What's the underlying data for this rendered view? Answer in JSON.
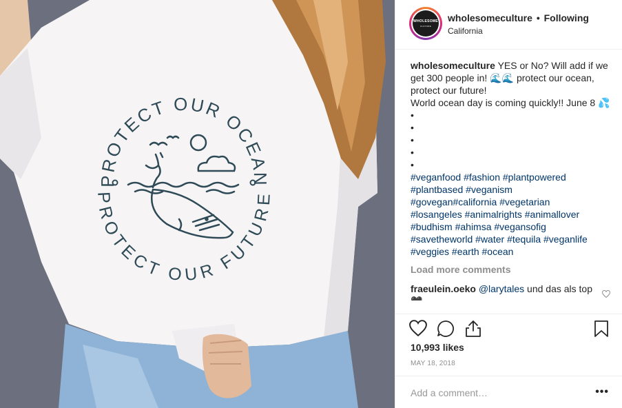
{
  "post": {
    "image": {
      "print_top": "PROTECT OUR OCEAN",
      "print_bottom": "PROTECT OUR FUTURE"
    },
    "header": {
      "avatar_text": "WHOLESOME",
      "avatar_sub": "CULTURE",
      "username": "wholesomeculture",
      "separator": "•",
      "follow_state": "Following",
      "location": "California"
    },
    "caption": {
      "author": "wholesomeculture",
      "text": "YES or No? Will add if we get 300 people in! 🌊🌊 protect our ocean, protect our future!",
      "line2": "World ocean day is coming quickly!! June 8 💦",
      "bullets": [
        "•",
        "•",
        "•",
        "•",
        "•"
      ],
      "hashtags": [
        "#veganfood #fashion #plantpowered",
        "#plantbased #veganism",
        "#govegan#california #vegetarian",
        "#losangeles #animalrights #animallover",
        "#budhism #ahimsa #vegansofig",
        "#savetheworld #water #tequila #veganlife",
        "#veggies #earth #ocean"
      ]
    },
    "load_more": "Load more comments",
    "comment": {
      "author": "fraeulein.oeko",
      "mention": "@larytales",
      "text": " und das als top 🖤"
    },
    "likes": "10,993 likes",
    "date": "MAY 18, 2018",
    "add_comment_placeholder": "Add a comment…",
    "more_label": "•••",
    "icons": [
      "heart-icon",
      "comment-icon",
      "share-icon",
      "bookmark-icon",
      "small-heart-icon"
    ]
  }
}
